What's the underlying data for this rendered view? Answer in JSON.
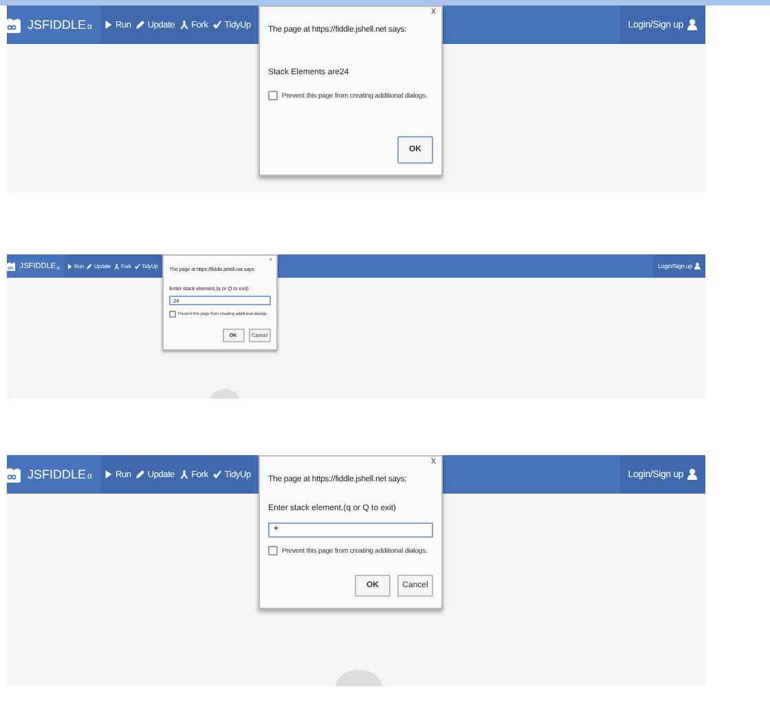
{
  "panels": [
    {
      "compact": false,
      "partial_circle": false,
      "header": {
        "logo": "JSFIDDLE",
        "logo_mark": "α",
        "nav": [
          {
            "kind": "run",
            "label": "Run"
          },
          {
            "kind": "update",
            "label": "Update"
          },
          {
            "kind": "fork",
            "label": "Fork"
          },
          {
            "kind": "tidy",
            "label": "TidyUp"
          }
        ],
        "login": "Login/Sign up"
      },
      "dialog": {
        "kind": "alert",
        "title": "The page at https://fiddle.jshell.net says:",
        "close": "x",
        "message": "Stack Elements are24",
        "checkbox": {
          "label": "Prevent this page from creating additional dialogs.",
          "checked": false
        },
        "buttons": [
          "OK"
        ]
      }
    },
    {
      "compact": true,
      "partial_circle": true,
      "header": {
        "logo": "JSFIDDLE",
        "logo_mark": "α",
        "nav": [
          {
            "kind": "run",
            "label": "Run"
          },
          {
            "kind": "update",
            "label": "Update"
          },
          {
            "kind": "fork",
            "label": "Fork"
          },
          {
            "kind": "tidy",
            "label": "TidyUp"
          }
        ],
        "login": "Login/Sign up"
      },
      "dialog": {
        "kind": "prompt",
        "title": "The page at https://fiddle.jshell.net says:",
        "close": "×",
        "message": "Enter stack element,(q or Q to exit)",
        "value": "24",
        "checkbox": {
          "label": "Prevent this page from creating additional dialogs.",
          "checked": false
        },
        "buttons": [
          "OK",
          "Cancel"
        ]
      }
    },
    {
      "compact": false,
      "partial_circle": true,
      "header": {
        "logo": "JSFIDDLE",
        "logo_mark": "α",
        "nav": [
          {
            "kind": "run",
            "label": "Run"
          },
          {
            "kind": "update",
            "label": "Update"
          },
          {
            "kind": "fork",
            "label": "Fork"
          },
          {
            "kind": "tidy",
            "label": "TidyUp"
          }
        ],
        "login": "Login/Sign up"
      },
      "dialog": {
        "kind": "prompt",
        "title": "The page at https://fiddle.jshell.net says:",
        "close": "x",
        "message": "Enter stack element,(q or Q to exit)",
        "value": "+",
        "checkbox": {
          "label": "Prevent this page from creating additional dialogs.",
          "checked": false
        },
        "buttons": [
          "OK",
          "Cancel"
        ]
      }
    }
  ]
}
